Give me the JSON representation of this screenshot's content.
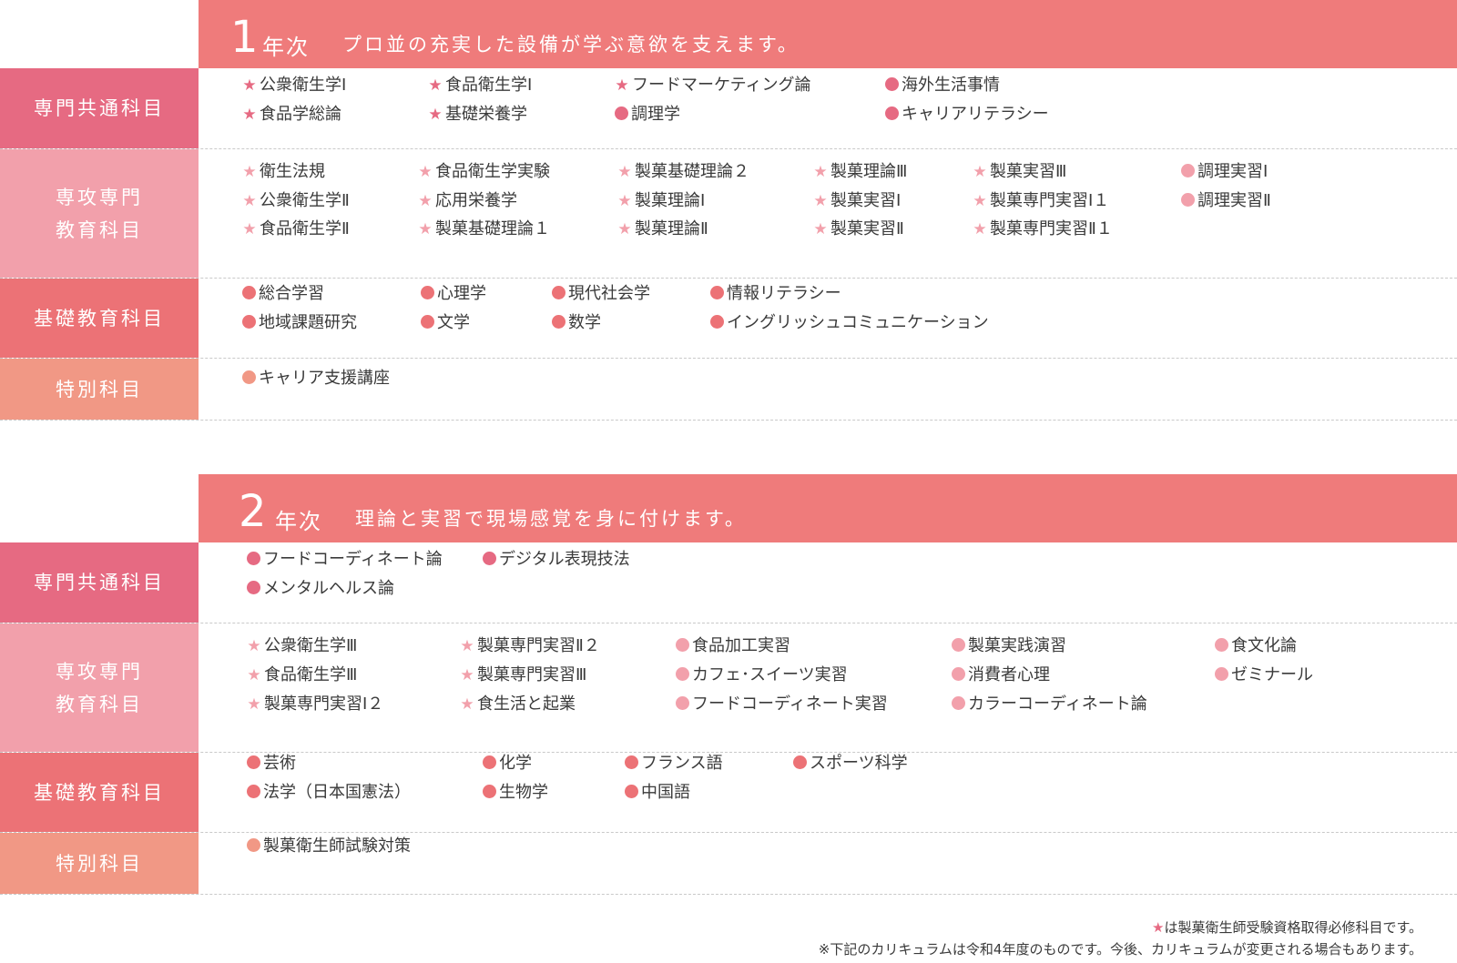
{
  "colors": {
    "header": "#ef7b7b",
    "common": "#e66a82",
    "major": "#f2a0ab",
    "basic": "#ec7276",
    "special": "#f19885"
  },
  "years": [
    {
      "number": "1",
      "word": "年次",
      "tagline": "プロ並の充実した設備が学ぶ意欲を支えます。",
      "rows": {
        "common": {
          "label": "専門共通科目",
          "items": [
            {
              "m": "star",
              "t": "公衆衛生学Ⅰ"
            },
            {
              "m": "star",
              "t": "食品学総論"
            },
            {
              "m": "star",
              "t": "食品衛生学Ⅰ"
            },
            {
              "m": "star",
              "t": "基礎栄養学"
            },
            {
              "m": "star",
              "t": "フードマーケティング論"
            },
            {
              "m": "dot",
              "t": "調理学"
            },
            {
              "m": "dot",
              "t": "海外生活事情"
            },
            {
              "m": "dot",
              "t": "キャリアリテラシー"
            }
          ]
        },
        "major": {
          "label": "専攻専門\n教育科目",
          "items": [
            {
              "m": "star",
              "t": "衛生法規"
            },
            {
              "m": "star",
              "t": "公衆衛生学Ⅱ"
            },
            {
              "m": "star",
              "t": "食品衛生学Ⅱ"
            },
            {
              "m": "star",
              "t": "食品衛生学実験"
            },
            {
              "m": "star",
              "t": "応用栄養学"
            },
            {
              "m": "star",
              "t": "製菓基礎理論１"
            },
            {
              "m": "star",
              "t": "製菓基礎理論２"
            },
            {
              "m": "star",
              "t": "製菓理論Ⅰ"
            },
            {
              "m": "star",
              "t": "製菓理論Ⅱ"
            },
            {
              "m": "star",
              "t": "製菓理論Ⅲ"
            },
            {
              "m": "star",
              "t": "製菓実習Ⅰ"
            },
            {
              "m": "star",
              "t": "製菓実習Ⅱ"
            },
            {
              "m": "star",
              "t": "製菓実習Ⅲ"
            },
            {
              "m": "star",
              "t": "製菓専門実習Ⅰ１"
            },
            {
              "m": "star",
              "t": "製菓専門実習Ⅱ１"
            },
            {
              "m": "dot",
              "t": "調理実習Ⅰ"
            },
            {
              "m": "dot",
              "t": "調理実習Ⅱ"
            }
          ]
        },
        "basic": {
          "label": "基礎教育科目",
          "items": [
            {
              "m": "dot",
              "t": "総合学習"
            },
            {
              "m": "dot",
              "t": "地域課題研究"
            },
            {
              "m": "dot",
              "t": "心理学"
            },
            {
              "m": "dot",
              "t": "文学"
            },
            {
              "m": "dot",
              "t": "現代社会学"
            },
            {
              "m": "dot",
              "t": "数学"
            },
            {
              "m": "dot",
              "t": "情報リテラシー"
            },
            {
              "m": "dot",
              "t": "イングリッシュコミュニケーション"
            }
          ]
        },
        "special": {
          "label": "特別科目",
          "items": [
            {
              "m": "dot",
              "t": "キャリア支援講座"
            }
          ]
        }
      }
    },
    {
      "number": "2",
      "word": "年次",
      "tagline": "理論と実習で現場感覚を身に付けます。",
      "rows": {
        "common": {
          "label": "専門共通科目",
          "items": [
            {
              "m": "dot",
              "t": "フードコーディネート論"
            },
            {
              "m": "dot",
              "t": "メンタルヘルス論"
            },
            {
              "m": "dot",
              "t": "デジタル表現技法"
            }
          ]
        },
        "major": {
          "label": "専攻専門\n教育科目",
          "items": [
            {
              "m": "star",
              "t": "公衆衛生学Ⅲ"
            },
            {
              "m": "star",
              "t": "食品衛生学Ⅲ"
            },
            {
              "m": "star",
              "t": "製菓専門実習Ⅰ２"
            },
            {
              "m": "star",
              "t": "製菓専門実習Ⅱ２"
            },
            {
              "m": "star",
              "t": "製菓専門実習Ⅲ"
            },
            {
              "m": "star",
              "t": "食生活と起業"
            },
            {
              "m": "dot",
              "t": "食品加工実習"
            },
            {
              "m": "dot",
              "t": "カフェ･スイーツ実習"
            },
            {
              "m": "dot",
              "t": "フードコーディネート実習"
            },
            {
              "m": "dot",
              "t": "製菓実践演習"
            },
            {
              "m": "dot",
              "t": "消費者心理"
            },
            {
              "m": "dot",
              "t": "カラーコーディネート論"
            },
            {
              "m": "dot",
              "t": "食文化論"
            },
            {
              "m": "dot",
              "t": "ゼミナール"
            }
          ]
        },
        "basic": {
          "label": "基礎教育科目",
          "items": [
            {
              "m": "dot",
              "t": "芸術"
            },
            {
              "m": "dot",
              "t": "法学（日本国憲法）"
            },
            {
              "m": "dot",
              "t": "化学"
            },
            {
              "m": "dot",
              "t": "生物学"
            },
            {
              "m": "dot",
              "t": "フランス語"
            },
            {
              "m": "dot",
              "t": "中国語"
            },
            {
              "m": "dot",
              "t": "スポーツ科学"
            }
          ]
        },
        "special": {
          "label": "特別科目",
          "items": [
            {
              "m": "dot",
              "t": "製菓衛生師試験対策"
            }
          ]
        }
      }
    }
  ],
  "footnotes": {
    "star_symbol": "★",
    "star_note": "は製菓衛生師受験資格取得必修科目です。",
    "curriculum_note": "※下記のカリキュラムは令和4年度のものです。今後、カリキュラムが変更される場合もあります。"
  }
}
